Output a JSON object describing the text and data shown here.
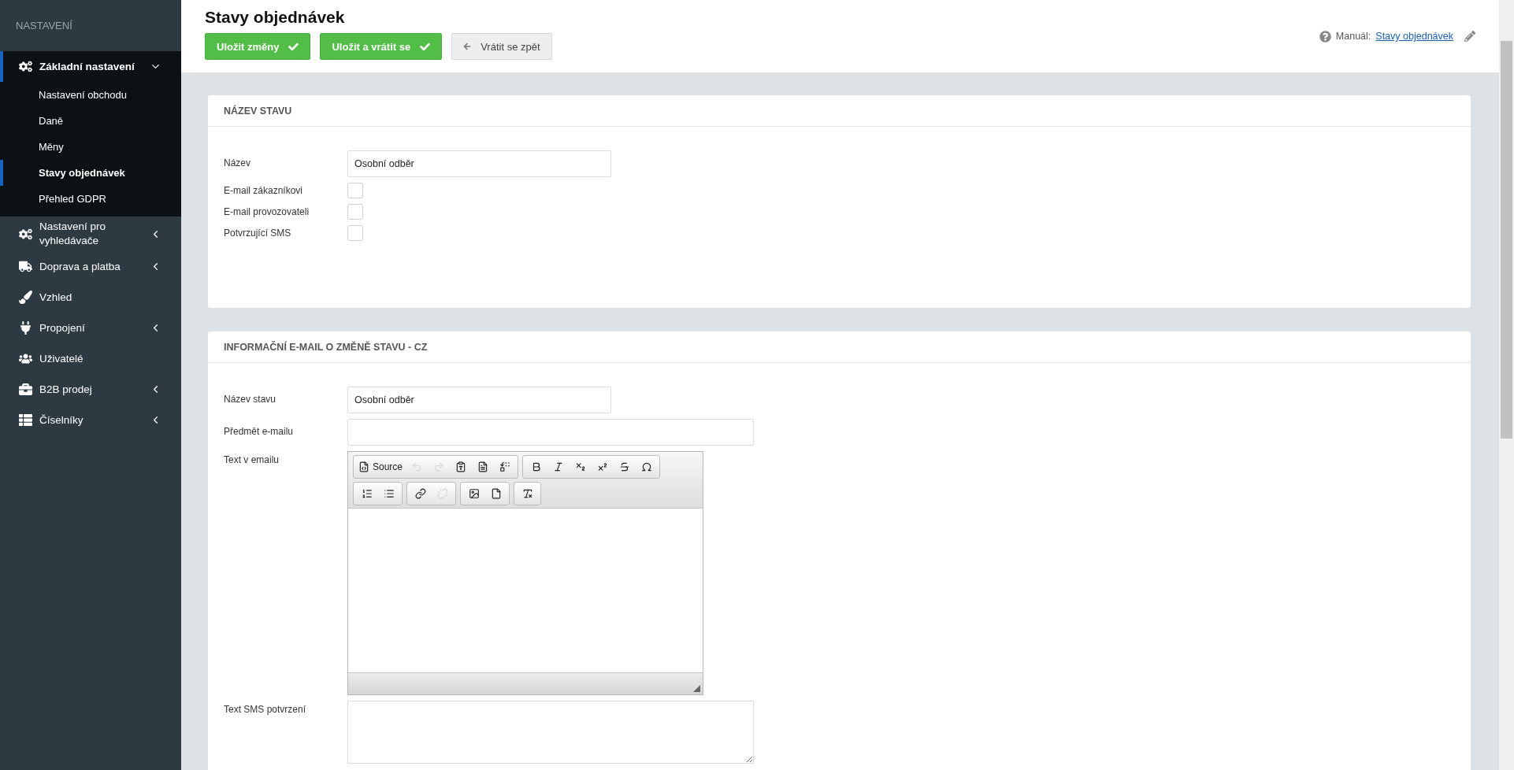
{
  "sidebar": {
    "heading": "NASTAVENÍ",
    "items": [
      {
        "kind": "gears",
        "label": "Základní nastavení",
        "expandable": true,
        "expanded": true,
        "selected": true,
        "children": [
          {
            "label": "Nastavení obchodu",
            "selected": false
          },
          {
            "label": "Daně",
            "selected": false
          },
          {
            "label": "Měny",
            "selected": false
          },
          {
            "label": "Stavy objednávek",
            "selected": true
          },
          {
            "label": "Přehled GDPR",
            "selected": false
          }
        ]
      },
      {
        "kind": "gears",
        "label": "Nastavení pro vyhledávače",
        "expandable": true,
        "expanded": false,
        "selected": false
      },
      {
        "kind": "truck",
        "label": "Doprava a platba",
        "expandable": true,
        "expanded": false,
        "selected": false
      },
      {
        "kind": "brush",
        "label": "Vzhled",
        "expandable": false,
        "expanded": false,
        "selected": false
      },
      {
        "kind": "plug",
        "label": "Propojení",
        "expandable": true,
        "expanded": false,
        "selected": false
      },
      {
        "kind": "users",
        "label": "Uživatelé",
        "expandable": false,
        "expanded": false,
        "selected": false
      },
      {
        "kind": "briefcase",
        "label": "B2B prodej",
        "expandable": true,
        "expanded": false,
        "selected": false
      },
      {
        "kind": "table",
        "label": "Číselníky",
        "expandable": true,
        "expanded": false,
        "selected": false
      }
    ]
  },
  "header": {
    "title": "Stavy objednávek",
    "buttons": [
      {
        "kind": "save",
        "label": "Uložit změny"
      },
      {
        "kind": "save",
        "label": "Uložit a vrátit se"
      },
      {
        "kind": "back",
        "label": "Vrátit se zpět"
      }
    ],
    "manual_label": "Manuál:",
    "manual_link": "Stavy objednávek"
  },
  "panels": [
    {
      "title": "NÁZEV STAVU",
      "fields": [
        {
          "kind": "text",
          "label": "Název",
          "value": "Osobní odběr"
        },
        {
          "kind": "checkbox",
          "label": "E-mail zákazníkovi",
          "checked": false
        },
        {
          "kind": "checkbox",
          "label": "E-mail provozovateli",
          "checked": false
        },
        {
          "kind": "checkbox",
          "label": "Potvrzující SMS",
          "checked": false
        }
      ]
    },
    {
      "title": "INFORMAČNÍ E-MAIL O ZMĚNĚ STAVU - CZ",
      "fields": [
        {
          "kind": "text",
          "label": "Název stavu",
          "value": "Osobní odběr"
        },
        {
          "kind": "wide-text",
          "label": "Předmět e-mailu"
        },
        {
          "kind": "editor",
          "label": "Text v emailu",
          "toolbar": [
            [
              [
                {
                  "kind": "source",
                  "label": "Source",
                  "disabled": false
                },
                {
                  "kind": "undo",
                  "disabled": true
                },
                {
                  "kind": "redo",
                  "disabled": true
                },
                {
                  "kind": "paste-text",
                  "disabled": false
                },
                {
                  "kind": "paste-word",
                  "disabled": false
                },
                {
                  "kind": "replace",
                  "disabled": false
                }
              ],
              [
                {
                  "kind": "bold",
                  "disabled": false
                },
                {
                  "kind": "italic",
                  "disabled": false
                },
                {
                  "kind": "subscript",
                  "disabled": false
                },
                {
                  "kind": "superscript",
                  "disabled": false
                },
                {
                  "kind": "strike",
                  "disabled": false
                },
                {
                  "kind": "omega",
                  "disabled": false
                }
              ]
            ],
            [
              [
                {
                  "kind": "ordered-list",
                  "disabled": false
                },
                {
                  "kind": "bullet-list",
                  "disabled": false
                }
              ],
              [
                {
                  "kind": "link",
                  "disabled": false
                },
                {
                  "kind": "unlink",
                  "disabled": true
                }
              ],
              [
                {
                  "kind": "image",
                  "disabled": false
                },
                {
                  "kind": "document",
                  "disabled": false
                }
              ],
              [
                {
                  "kind": "remove-format",
                  "disabled": false
                }
              ]
            ]
          ]
        },
        {
          "kind": "textarea",
          "label": "Text SMS potvrzení"
        }
      ]
    }
  ]
}
